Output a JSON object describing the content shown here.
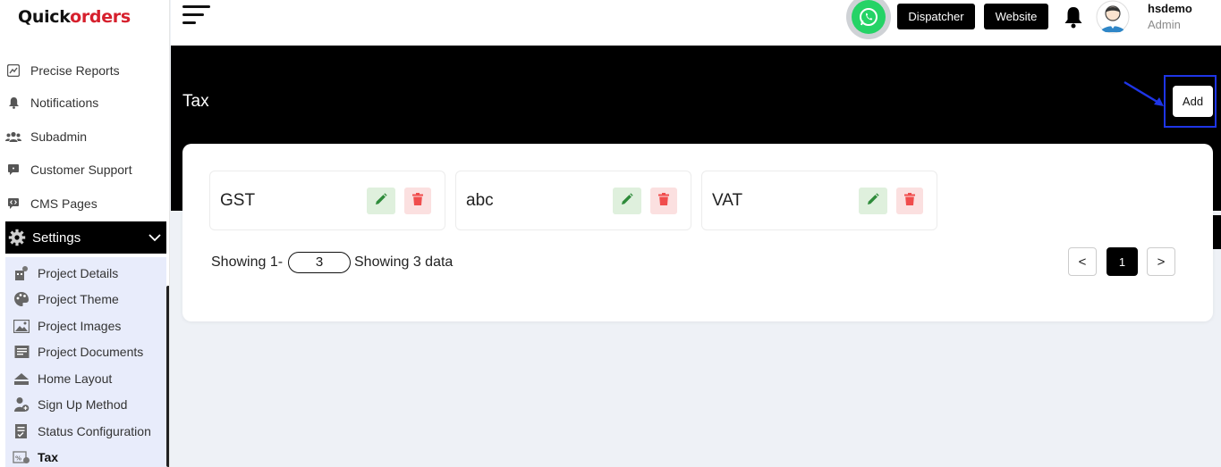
{
  "brand": {
    "part1": "Quick",
    "part2": "orders"
  },
  "sidebar": {
    "items": [
      {
        "label": "Precise Reports",
        "icon": "chart-icon"
      },
      {
        "label": "Notifications",
        "icon": "bell-icon"
      },
      {
        "label": "Subadmin",
        "icon": "users-icon"
      },
      {
        "label": "Customer Support",
        "icon": "chat-icon"
      },
      {
        "label": "CMS Pages",
        "icon": "code-icon"
      }
    ],
    "settings_label": "Settings",
    "sub_items": [
      {
        "label": "Project Details",
        "icon": "project-details-icon"
      },
      {
        "label": "Project Theme",
        "icon": "palette-icon"
      },
      {
        "label": "Project Images",
        "icon": "image-icon"
      },
      {
        "label": "Project Documents",
        "icon": "document-icon"
      },
      {
        "label": "Home Layout",
        "icon": "home-icon"
      },
      {
        "label": "Sign Up Method",
        "icon": "user-add-icon"
      },
      {
        "label": "Status Configuration",
        "icon": "checklist-icon"
      },
      {
        "label": "Tax",
        "icon": "tax-icon"
      }
    ]
  },
  "topbar": {
    "dispatcher_label": "Dispatcher",
    "website_label": "Website",
    "user_name": "hsdemo",
    "user_role": "Admin"
  },
  "page": {
    "title": "Tax",
    "add_label": "Add"
  },
  "taxes": [
    {
      "name": "GST"
    },
    {
      "name": "abc"
    },
    {
      "name": "VAT"
    }
  ],
  "pagination": {
    "showing_prefix": "Showing 1-",
    "per_page": "3",
    "showing_suffix": "Showing 3 data",
    "prev": "<",
    "current": "1",
    "next": ">"
  },
  "colors": {
    "accent": "#000000",
    "highlight": "#1e35e6",
    "edit_bg": "#dff0dd",
    "edit_icon": "#2e8b3a",
    "delete_bg": "#fbe0e0",
    "delete_icon": "#f04d4d"
  }
}
